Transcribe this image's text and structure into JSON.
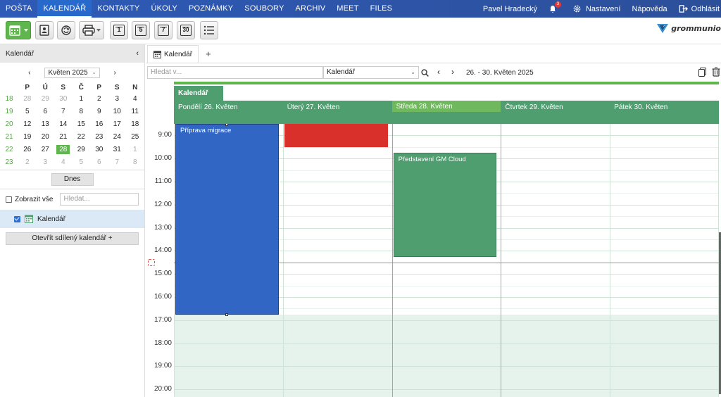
{
  "topnav": {
    "tabs": [
      {
        "label": "POŠTA"
      },
      {
        "label": "KALENDÁŘ",
        "active": true
      },
      {
        "label": "KONTAKTY"
      },
      {
        "label": "ÚKOLY"
      },
      {
        "label": "POZNÁMKY"
      },
      {
        "label": "SOUBORY"
      },
      {
        "label": "ARCHIV"
      },
      {
        "label": "MEET"
      },
      {
        "label": "FILES"
      }
    ],
    "user": "Pavel Hradecký",
    "notification_count": "3",
    "settings": "Nastavení",
    "help": "Nápověda",
    "logout": "Odhlásit"
  },
  "brand": {
    "logo_text": "grommunio",
    "accent": "#5fb64c"
  },
  "toolbar": {
    "icons": [
      "calendar-icon",
      "contacts-icon",
      "refresh-icon",
      "print-icon",
      "day-view-icon",
      "workweek-view-icon",
      "week-view-icon",
      "month-view-icon",
      "list-view-icon"
    ],
    "view_numbers": [
      "1",
      "5",
      "7",
      "30"
    ]
  },
  "sidebar": {
    "title": "Kalendář",
    "month_label": "Květen 2025",
    "weekdays": [
      "P",
      "Ú",
      "S",
      "Č",
      "P",
      "S",
      "N"
    ],
    "weeks": [
      {
        "wk": "18",
        "days": [
          {
            "d": "28",
            "m": true
          },
          {
            "d": "29",
            "m": true
          },
          {
            "d": "30",
            "m": true
          },
          {
            "d": "1"
          },
          {
            "d": "2"
          },
          {
            "d": "3"
          },
          {
            "d": "4"
          }
        ]
      },
      {
        "wk": "19",
        "days": [
          {
            "d": "5"
          },
          {
            "d": "6"
          },
          {
            "d": "7"
          },
          {
            "d": "8"
          },
          {
            "d": "9"
          },
          {
            "d": "10"
          },
          {
            "d": "11"
          }
        ]
      },
      {
        "wk": "20",
        "days": [
          {
            "d": "12"
          },
          {
            "d": "13"
          },
          {
            "d": "14"
          },
          {
            "d": "15"
          },
          {
            "d": "16"
          },
          {
            "d": "17"
          },
          {
            "d": "18"
          }
        ]
      },
      {
        "wk": "21",
        "days": [
          {
            "d": "19"
          },
          {
            "d": "20"
          },
          {
            "d": "21"
          },
          {
            "d": "22"
          },
          {
            "d": "23"
          },
          {
            "d": "24"
          },
          {
            "d": "25"
          }
        ]
      },
      {
        "wk": "22",
        "days": [
          {
            "d": "26"
          },
          {
            "d": "27"
          },
          {
            "d": "28",
            "t": true
          },
          {
            "d": "29"
          },
          {
            "d": "30"
          },
          {
            "d": "31"
          },
          {
            "d": "1",
            "m": true
          }
        ]
      },
      {
        "wk": "23",
        "days": [
          {
            "d": "2",
            "m": true
          },
          {
            "d": "3",
            "m": true
          },
          {
            "d": "4",
            "m": true
          },
          {
            "d": "5",
            "m": true
          },
          {
            "d": "6",
            "m": true
          },
          {
            "d": "7",
            "m": true
          },
          {
            "d": "8",
            "m": true
          }
        ]
      }
    ],
    "today_button": "Dnes",
    "show_all": "Zobrazit vše",
    "search_placeholder": "Hledat...",
    "calendar_item": "Kalendář",
    "open_shared": "Otevřít sdílený kalendář +"
  },
  "main": {
    "tab_label": "Kalendář",
    "search_placeholder": "Hledat v...",
    "scope": "Kalendář",
    "date_range": "26. - 30. Květen 2025",
    "calendar_label": "Kalendář",
    "days": [
      "Pondělí 26. Květen",
      "Úterý 27. Květen",
      "Středa 28. Květen",
      "Čtvrtek 29. Květen",
      "Pátek 30. Květen"
    ],
    "today_index": 2,
    "hours": [
      "9:00",
      "10:00",
      "11:00",
      "12:00",
      "13:00",
      "14:00",
      "15:00",
      "16:00",
      "17:00",
      "18:00",
      "19:00",
      "20:00"
    ],
    "first_hour": 8.5,
    "now_hour": 14.5,
    "work_end_hour": 16.75,
    "events": [
      {
        "title": "Příprava migrace",
        "day": 0,
        "start": 8.5,
        "end": 16.75,
        "color": "blue",
        "selected": true
      },
      {
        "title": "",
        "day": 1,
        "start": 8.5,
        "end": 9.5,
        "color": "red"
      },
      {
        "title": "Představení GM Cloud",
        "day": 2,
        "start": 9.75,
        "end": 14.25,
        "color": "green"
      }
    ],
    "colors": {
      "event_blue": "#3266c5",
      "event_red": "#d9302c",
      "event_green": "#4e9e6f",
      "header_green": "#4e9e6f",
      "today_green": "#70b85e"
    }
  }
}
